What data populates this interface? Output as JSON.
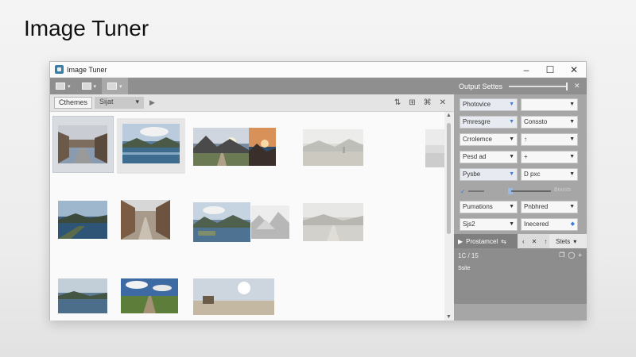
{
  "slide": {
    "title": "Image Tuner"
  },
  "window": {
    "title": "Image Tuner",
    "controls": {
      "minimize": "–",
      "maximize": "☐",
      "close": "✕"
    }
  },
  "toolbar": {
    "buttons": [
      {
        "icon": "import-icon",
        "caret": "▾"
      },
      {
        "icon": "copy-icon",
        "caret": "▾"
      },
      {
        "icon": "people-icon",
        "caret": "▾"
      }
    ]
  },
  "subtoolbar": {
    "filter_chip": "Cthemes",
    "select_value": "Sijat",
    "select_caret": "▾",
    "play": "▶",
    "right_icons": [
      "⇅",
      "⊞",
      "⌘",
      "✕"
    ]
  },
  "gallery": {
    "thumbnails": [
      {
        "name": "street-dusk",
        "row": 1
      },
      {
        "name": "lake-mountains",
        "row": 1
      },
      {
        "name": "mountain-road",
        "row": 1
      },
      {
        "name": "sunset-rocks",
        "row": 1
      },
      {
        "name": "faded-valley",
        "row": 1
      },
      {
        "name": "faded-edge",
        "row": 1
      },
      {
        "name": "lake-sky",
        "row": 2
      },
      {
        "name": "street-alley",
        "row": 2
      },
      {
        "name": "river-mountains",
        "row": 2
      },
      {
        "name": "mist-rocks",
        "row": 2
      },
      {
        "name": "faded-road",
        "row": 2
      },
      {
        "name": "calm-lake",
        "row": 3
      },
      {
        "name": "green-road",
        "row": 3
      },
      {
        "name": "beach-sun",
        "row": 3
      }
    ],
    "scroll_up": "▲",
    "scroll_down": "▼"
  },
  "panel": {
    "title": "Output Settes",
    "close": "✕",
    "fields": [
      {
        "left": "Photovice",
        "right": ""
      },
      {
        "left": "Pmresgre",
        "right": "Conssto"
      },
      {
        "left": "Crrolemce",
        "right": "↑"
      },
      {
        "left": "Pesd ad",
        "right": "+"
      },
      {
        "left": "Pysbe",
        "right": "D pxc"
      }
    ],
    "range_label": "Boosts",
    "fields2": [
      {
        "left": "Pumations",
        "right": "Pnbhred"
      },
      {
        "left": "Sjs2",
        "right": "Inecered"
      }
    ],
    "bar": {
      "play": "▶",
      "label": "Prostamcel",
      "share": "⇆",
      "nav_left": "‹",
      "nav_close": "✕",
      "nav_up": "↑",
      "save_label": "Stets",
      "save_caret": "▾"
    },
    "pager": "1C / 15",
    "pager_icons": [
      "❐",
      "◯",
      "+"
    ],
    "status": "Ssite"
  }
}
